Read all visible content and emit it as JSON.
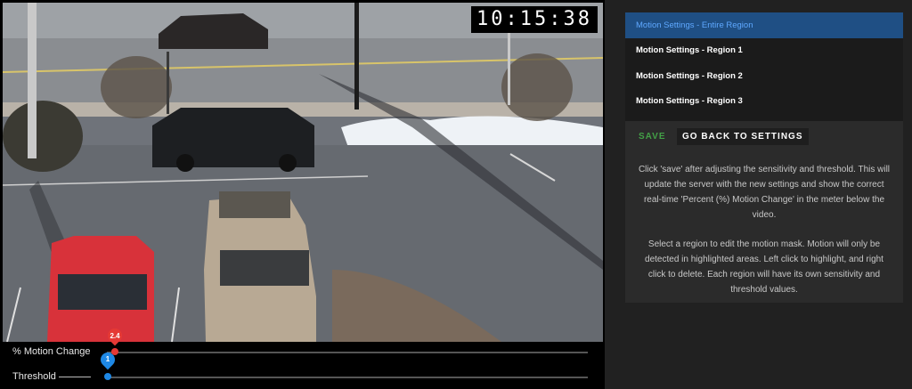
{
  "video": {
    "timestamp": "10:15:38"
  },
  "meters": {
    "motion_label": "% Motion Change",
    "motion_value": "2.4",
    "threshold_label": "Threshold",
    "threshold_value": "1"
  },
  "regions": [
    {
      "label": "Motion Settings - Entire Region",
      "active": true
    },
    {
      "label": "Motion Settings - Region 1",
      "active": false
    },
    {
      "label": "Motion Settings - Region 2",
      "active": false
    },
    {
      "label": "Motion Settings - Region 3",
      "active": false
    }
  ],
  "actions": {
    "save_label": "SAVE",
    "back_label": "GO BACK TO SETTINGS"
  },
  "help": {
    "paragraph_1": "Click 'save' after adjusting the sensitivity and threshold. This will update the server with the new settings and show the correct real-time 'Percent (%) Motion Change' in the meter below the video.",
    "paragraph_2": "Select a region to edit the motion mask. Motion will only be detected in highlighted areas. Left click to highlight, and right click to delete. Each region will have its own sensitivity and threshold values."
  },
  "colors": {
    "motion_accent": "#e53935",
    "threshold_accent": "#1e88e5",
    "active_region_bg": "#1f4f84",
    "save_green": "#43a047"
  }
}
